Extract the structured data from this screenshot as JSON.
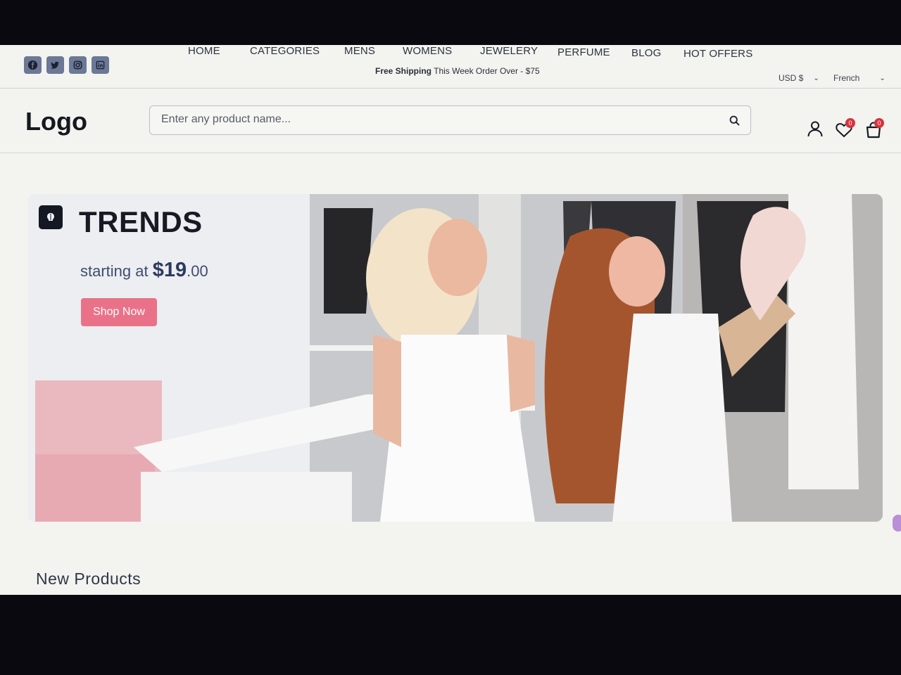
{
  "topbar": {
    "social_icons": [
      "facebook-icon",
      "twitter-icon",
      "instagram-icon",
      "linkedin-icon"
    ],
    "promo_bold": "Free Shipping",
    "promo_text": "This Week Order Over - $75",
    "currency": "USD $",
    "language": "French"
  },
  "header": {
    "logo": "Logo",
    "search_placeholder": "Enter any product name...",
    "wishlist_count": "0",
    "cart_count": "0"
  },
  "nav": {
    "items": [
      "HOME",
      "CATEGORIES",
      "MENS",
      "WOMENS",
      "JEWELERY",
      "PERFUME",
      "BLOG",
      "HOT OFFERS"
    ]
  },
  "hero": {
    "title": "TRENDS",
    "price_prefix": "starting at",
    "price_main": "$19",
    "price_cents": ".00",
    "button": "Shop Now"
  },
  "sections": {
    "new_products": "New Products"
  },
  "colors": {
    "accent": "#ea7288",
    "badge": "#d8323b",
    "dark": "#15181f"
  }
}
